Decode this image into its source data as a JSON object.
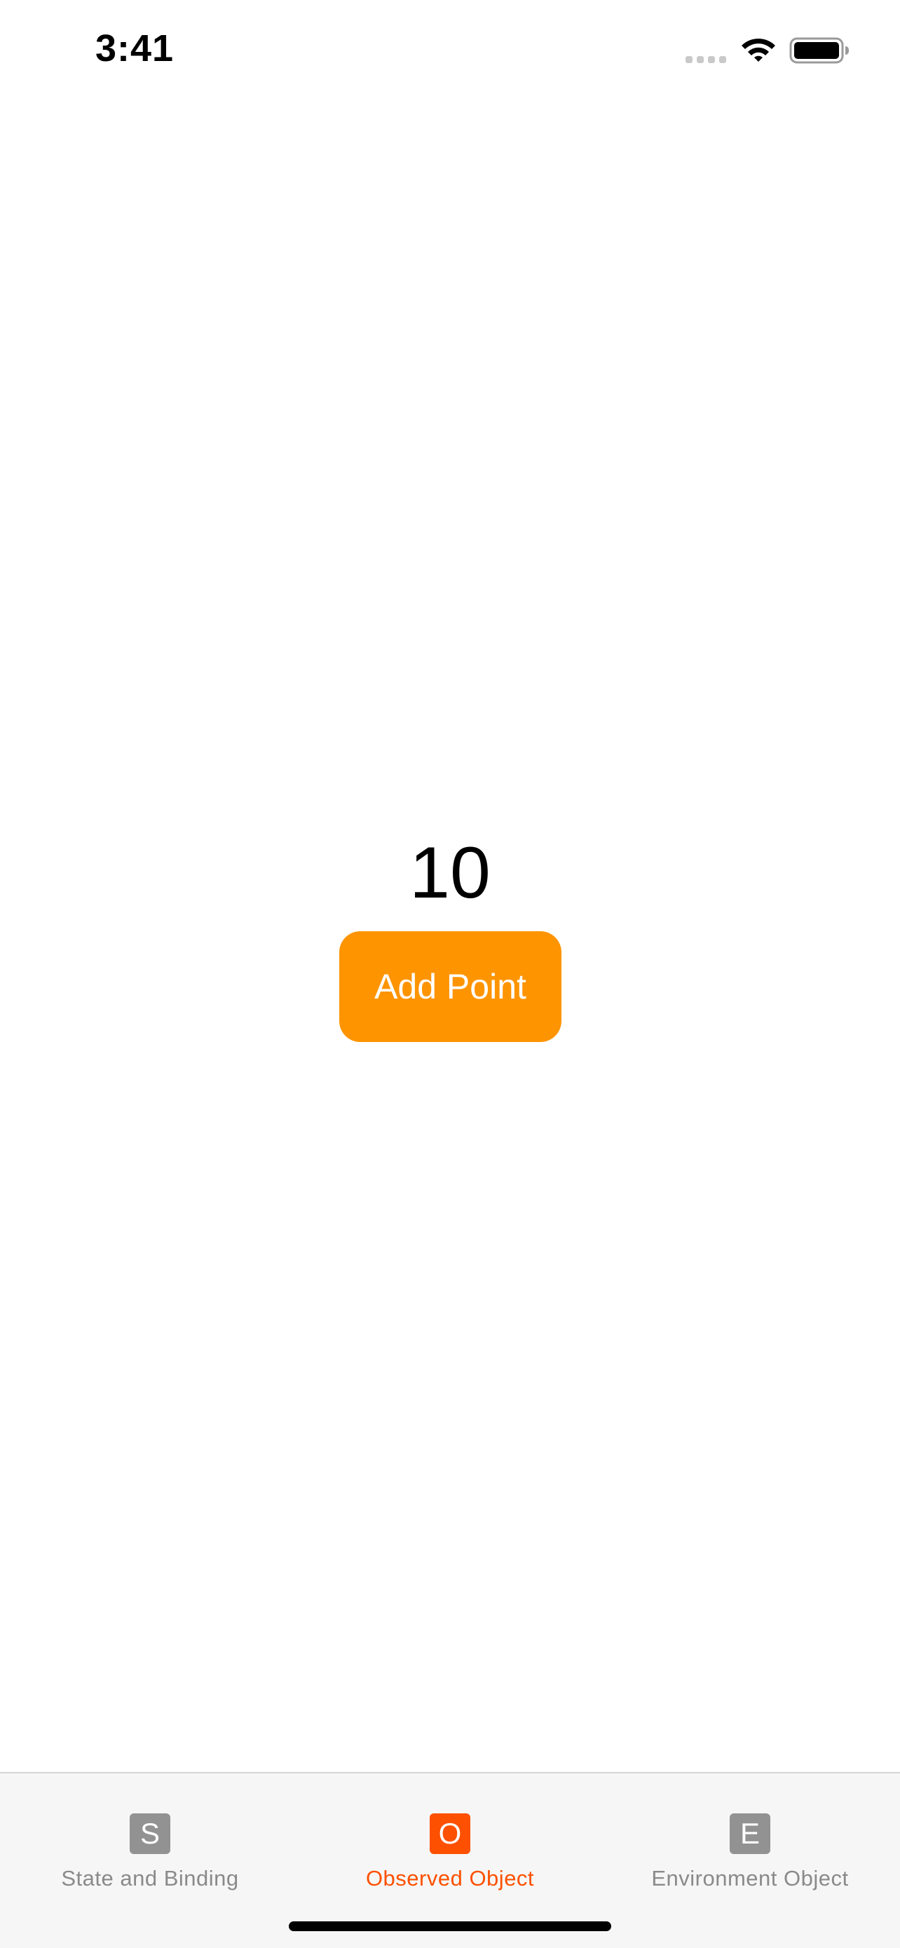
{
  "status_bar": {
    "time": "3:41",
    "icons": [
      "cellular-signal-icon",
      "wifi-icon",
      "battery-icon"
    ]
  },
  "main": {
    "counter_value": "10",
    "add_button_label": "Add Point"
  },
  "tab_bar": {
    "tabs": [
      {
        "icon_letter": "S",
        "label": "State and Binding",
        "selected": false
      },
      {
        "icon_letter": "O",
        "label": "Observed Object",
        "selected": true
      },
      {
        "icon_letter": "E",
        "label": "Environment Object",
        "selected": false
      }
    ]
  },
  "colors": {
    "accent": "#fe9400",
    "tab_selected": "#fd5000",
    "tab_unselected": "#8a8a8a"
  }
}
